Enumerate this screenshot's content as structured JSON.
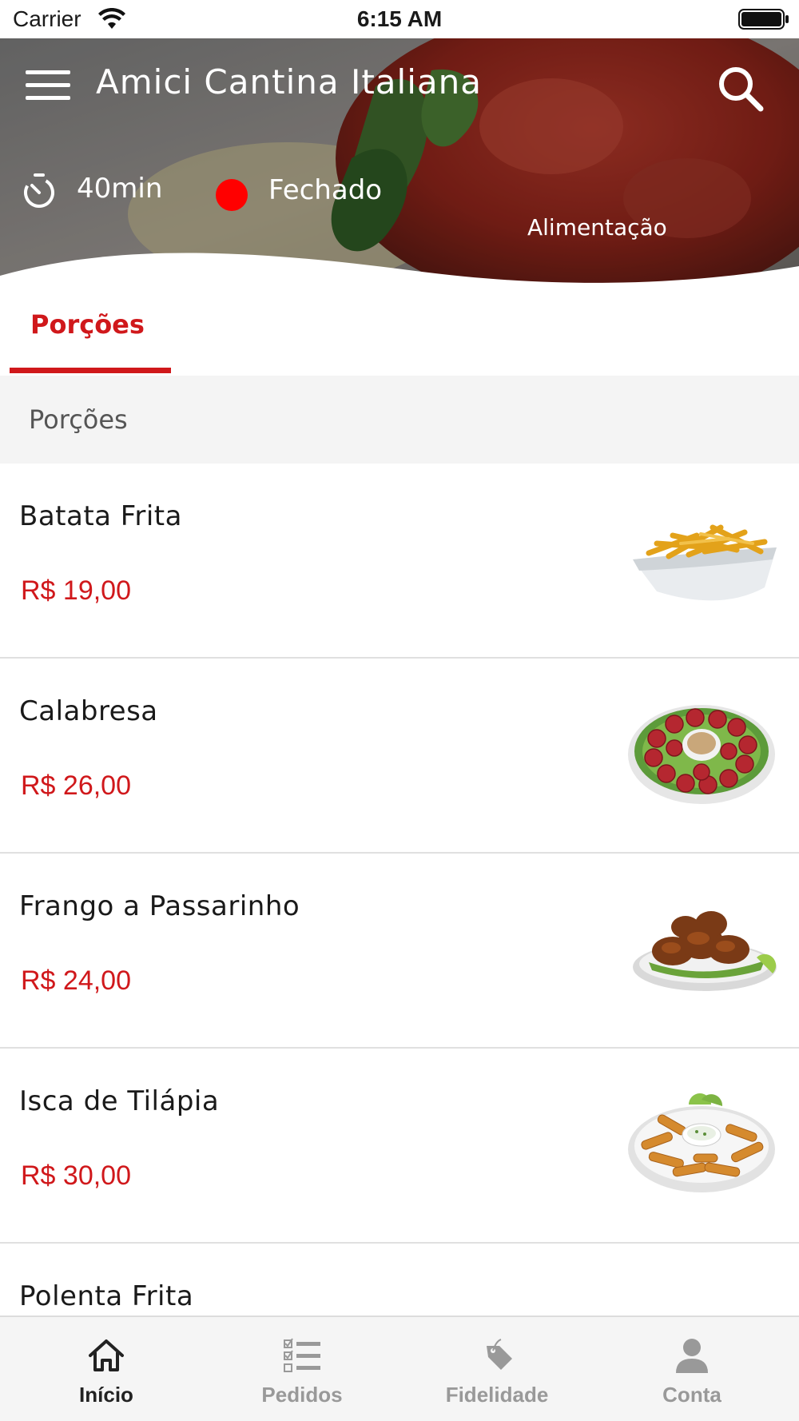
{
  "status_bar": {
    "carrier": "Carrier",
    "time": "6:15 AM"
  },
  "header": {
    "title": "Amici Cantina Italiana",
    "delivery_time": "40min",
    "status": "Fechado",
    "status_color": "#ff0000",
    "category": "Alimentação"
  },
  "tabs": [
    {
      "label": "Porções",
      "active": true
    }
  ],
  "section": {
    "title": "Porções"
  },
  "products": [
    {
      "name": "Batata Frita",
      "price": "R$ 19,00",
      "image": "fries-image"
    },
    {
      "name": "Calabresa",
      "price": "R$ 26,00",
      "image": "sausage-platter-image"
    },
    {
      "name": "Frango a Passarinho",
      "price": "R$ 24,00",
      "image": "fried-chicken-image"
    },
    {
      "name": "Isca de Tilápia",
      "price": "R$ 30,00",
      "image": "fish-strips-image"
    },
    {
      "name": "Polenta Frita",
      "price": "",
      "image": ""
    }
  ],
  "bottom_nav": [
    {
      "label": "Início",
      "icon": "home-icon",
      "active": true
    },
    {
      "label": "Pedidos",
      "icon": "checklist-icon",
      "active": false
    },
    {
      "label": "Fidelidade",
      "icon": "tag-icon",
      "active": false
    },
    {
      "label": "Conta",
      "icon": "user-icon",
      "active": false
    }
  ],
  "colors": {
    "accent": "#d0181b",
    "nav_inactive": "#999999"
  }
}
